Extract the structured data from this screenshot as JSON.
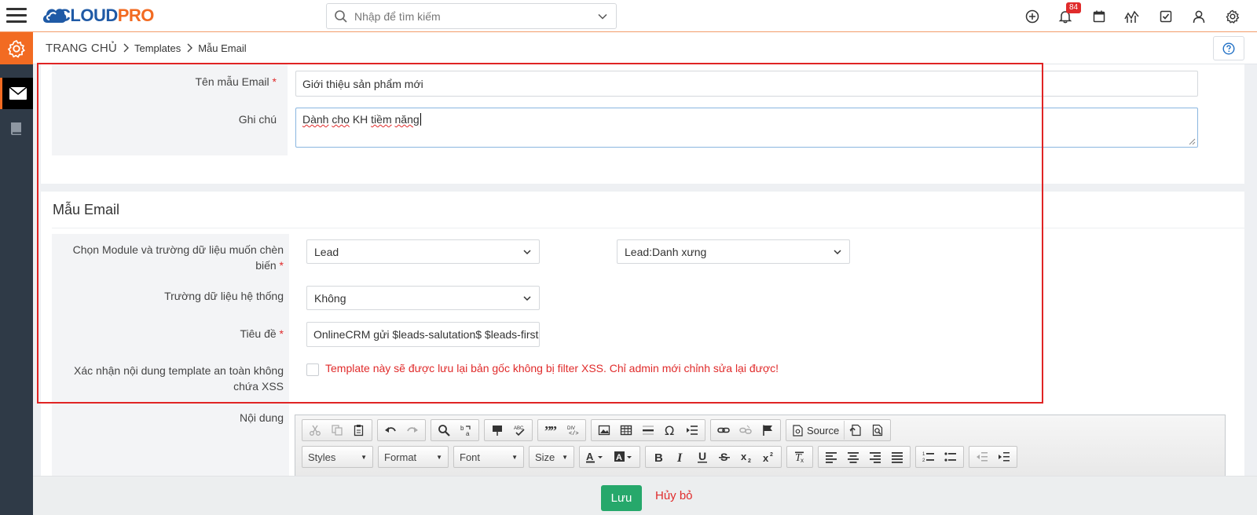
{
  "header": {
    "logo_prefix": "C",
    "logo_mid": "LOUD",
    "logo_suffix": "PRO",
    "search_placeholder": "Nhập để tìm kiếm",
    "notification_count": "84"
  },
  "breadcrumb": {
    "home": "TRANG CHỦ",
    "items": [
      "Templates",
      "Mẫu Email"
    ]
  },
  "form_general": {
    "template_name_label": "Tên mẫu Email",
    "template_name_value": "Giới thiệu sản phẩm mới",
    "note_label": "Ghi chú",
    "note_words": [
      "Dành",
      "cho",
      "KH",
      "tiềm",
      "năng"
    ]
  },
  "email_section": {
    "title": "Mẫu Email",
    "module_label_line1": "Chọn Module và trường dữ liệu muốn chèn",
    "module_label_line2": "biến",
    "module_value": "Lead",
    "field_value": "Lead:Danh xưng",
    "system_field_label": "Trường dữ liệu hệ thống",
    "system_field_value": "Không",
    "subject_label": "Tiêu đề",
    "subject_value": "OnlineCRM gửi $leads-salutation$ $leads-firstname$",
    "xss_label_line1": "Xác nhận nội dung template an toàn không",
    "xss_label_line2": "chứa XSS",
    "xss_message": "Template này sẽ được lưu lại bản gốc không bị filter XSS. Chỉ admin mới chỉnh sửa lại được!",
    "content_label": "Nội dung"
  },
  "editor": {
    "source_label": "Source",
    "combo_styles": "Styles",
    "combo_format": "Format",
    "combo_font": "Font",
    "combo_size": "Size"
  },
  "footer": {
    "save_label": "Lưu",
    "cancel_label": "Hủy bỏ"
  },
  "colors": {
    "accent_orange": "#f26b22",
    "brand_blue": "#1f5aa6",
    "save_green": "#26a86b",
    "required_red": "#e02b2b",
    "sidebar_dark": "#2f3a47"
  }
}
